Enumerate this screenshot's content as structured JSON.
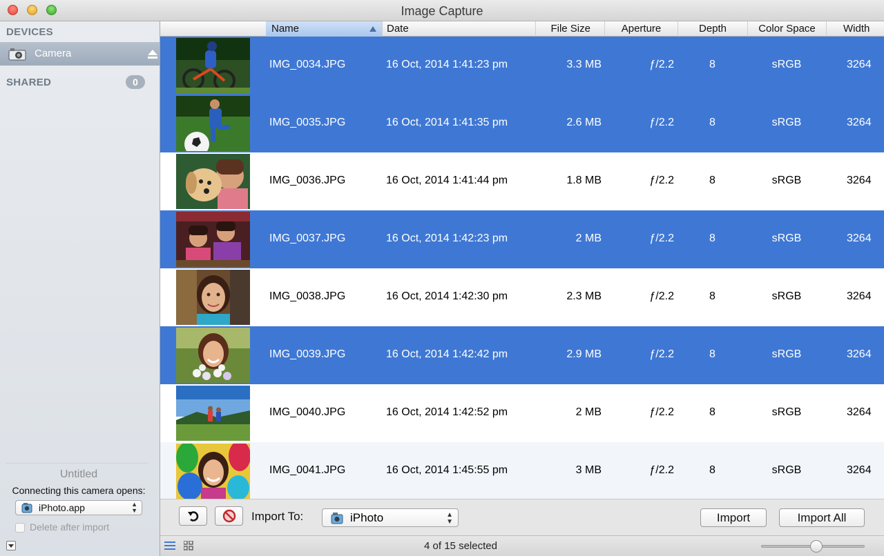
{
  "window": {
    "title": "Image Capture"
  },
  "sidebar": {
    "devices_heading": "DEVICES",
    "device_name": "Camera",
    "shared_heading": "SHARED",
    "shared_count": "0",
    "device_label": "Untitled",
    "connecting_label": "Connecting this camera opens:",
    "opens_app": "iPhoto.app",
    "delete_after_import": "Delete after import"
  },
  "table": {
    "columns": [
      "Name",
      "Date",
      "File Size",
      "Aperture",
      "Depth",
      "Color Space",
      "Width"
    ],
    "sorted_column": "Name",
    "rows": [
      {
        "name": "IMG_0034.JPG",
        "date": "16 Oct, 2014 1:41:23 pm",
        "size": "3.3 MB",
        "aperture": "ƒ/2.2",
        "depth": "8",
        "space": "sRGB",
        "width": "3264",
        "selected": true,
        "thumb": "bike"
      },
      {
        "name": "IMG_0035.JPG",
        "date": "16 Oct, 2014 1:41:35 pm",
        "size": "2.6 MB",
        "aperture": "ƒ/2.2",
        "depth": "8",
        "space": "sRGB",
        "width": "3264",
        "selected": true,
        "thumb": "soccer"
      },
      {
        "name": "IMG_0036.JPG",
        "date": "16 Oct, 2014 1:41:44 pm",
        "size": "1.8 MB",
        "aperture": "ƒ/2.2",
        "depth": "8",
        "space": "sRGB",
        "width": "3264",
        "selected": false,
        "thumb": "puppy"
      },
      {
        "name": "IMG_0037.JPG",
        "date": "16 Oct, 2014 1:42:23 pm",
        "size": "2 MB",
        "aperture": "ƒ/2.2",
        "depth": "8",
        "space": "sRGB",
        "width": "3264",
        "selected": true,
        "thumb": "sisters"
      },
      {
        "name": "IMG_0038.JPG",
        "date": "16 Oct, 2014 1:42:30 pm",
        "size": "2.3 MB",
        "aperture": "ƒ/2.2",
        "depth": "8",
        "space": "sRGB",
        "width": "3264",
        "selected": false,
        "thumb": "girl"
      },
      {
        "name": "IMG_0039.JPG",
        "date": "16 Oct, 2014 1:42:42 pm",
        "size": "2.9 MB",
        "aperture": "ƒ/2.2",
        "depth": "8",
        "space": "sRGB",
        "width": "3264",
        "selected": true,
        "thumb": "flowers"
      },
      {
        "name": "IMG_0040.JPG",
        "date": "16 Oct, 2014 1:42:52 pm",
        "size": "2 MB",
        "aperture": "ƒ/2.2",
        "depth": "8",
        "space": "sRGB",
        "width": "3264",
        "selected": false,
        "thumb": "hikers"
      },
      {
        "name": "IMG_0041.JPG",
        "date": "16 Oct, 2014 1:45:55 pm",
        "size": "3 MB",
        "aperture": "ƒ/2.2",
        "depth": "8",
        "space": "sRGB",
        "width": "3264",
        "selected": false,
        "thumb": "balloons"
      }
    ]
  },
  "toolbar": {
    "rotate_icon": "rotate-left-icon",
    "delete_icon": "delete-icon",
    "import_to_label": "Import To:",
    "import_destination": "iPhoto",
    "import_label": "Import",
    "import_all_label": "Import All"
  },
  "statusbar": {
    "selection_text": "4 of 15 selected",
    "thumbnail_size_fraction": 0.53
  },
  "colors": {
    "selection": "#3f78d4",
    "sidebar_selected": "#a4b0bf"
  }
}
